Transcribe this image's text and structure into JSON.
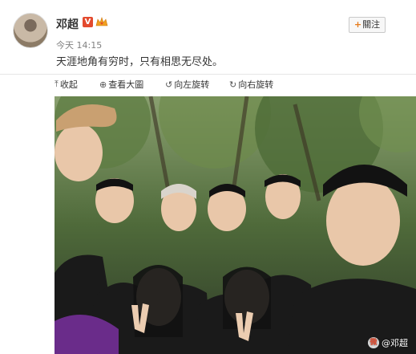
{
  "post": {
    "username": "邓超",
    "timestamp": "今天 14:15",
    "text": "天涯地角有穷时，只有相思无尽处。",
    "follow_label": "關注",
    "verified_badge": "V"
  },
  "toolbar": {
    "collapse_label": "收起",
    "view_large_label": "查看大圖",
    "rotate_left_label": "向左旋转",
    "rotate_right_label": "向右旋转"
  },
  "photo": {
    "watermark": "@邓超"
  },
  "colors": {
    "verified": "#e34a2e",
    "follow_plus": "#e67b1c",
    "text": "#333333",
    "muted": "#808080"
  },
  "icons": [
    "avatar",
    "verified-icon",
    "member-icon",
    "collapse-icon",
    "zoom-icon",
    "rotate-left-icon",
    "rotate-right-icon",
    "weibo-logo-icon"
  ]
}
